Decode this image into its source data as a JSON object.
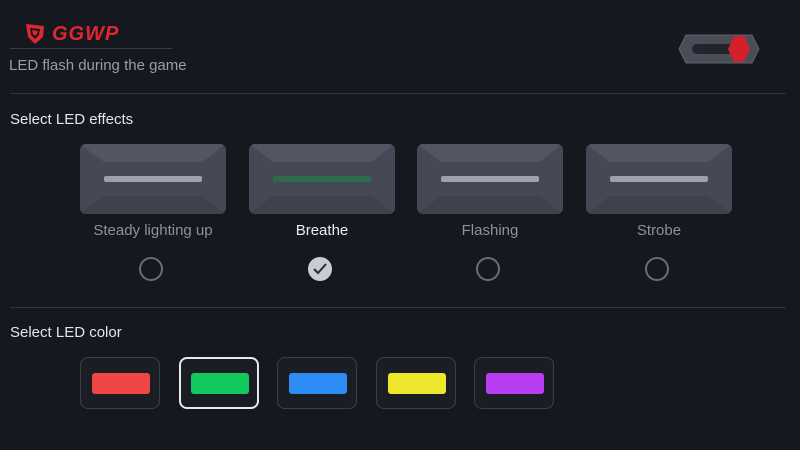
{
  "header": {
    "logo_text": "GGWP",
    "flash_label": "LED flash during the game",
    "toggle_on": true,
    "toggle_color": "#d4202b"
  },
  "effects_section": {
    "title": "Select LED effects",
    "items": [
      {
        "label": "Steady lighting up",
        "selected": false,
        "bar_color": "#9ea1aa"
      },
      {
        "label": "Breathe",
        "selected": true,
        "bar_color": "#2e6b4c"
      },
      {
        "label": "Flashing",
        "selected": false,
        "bar_color": "#9ea1aa"
      },
      {
        "label": "Strobe",
        "selected": false,
        "bar_color": "#9ea1aa"
      }
    ]
  },
  "color_section": {
    "title": "Select LED color",
    "colors": [
      {
        "name": "red",
        "hex": "#f04646",
        "selected": false
      },
      {
        "name": "green",
        "hex": "#12c95e",
        "selected": true
      },
      {
        "name": "blue",
        "hex": "#2e8df5",
        "selected": false
      },
      {
        "name": "yellow",
        "hex": "#eee62b",
        "selected": false
      },
      {
        "name": "purple",
        "hex": "#b93ef2",
        "selected": false
      }
    ]
  }
}
